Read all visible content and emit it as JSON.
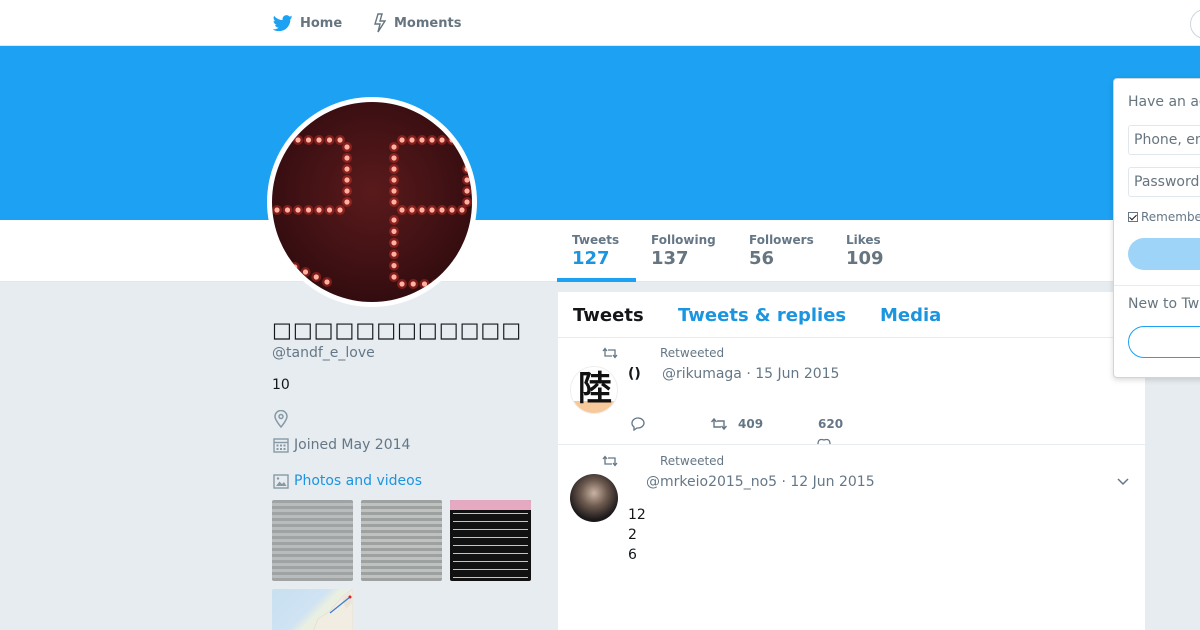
{
  "nav": {
    "home_label": "Home",
    "moments_label": "Moments"
  },
  "profile": {
    "name": "□□□□□□□□□□□□",
    "handle": "@tandf_e_love",
    "bio": "10",
    "joined": "Joined May 2014",
    "photos_label": "Photos and videos",
    "avatar_digits": "28"
  },
  "stats": [
    {
      "label": "Tweets",
      "value": "127"
    },
    {
      "label": "Following",
      "value": "137"
    },
    {
      "label": "Followers",
      "value": "56"
    },
    {
      "label": "Likes",
      "value": "109"
    }
  ],
  "tabs": {
    "tweets": "Tweets",
    "replies": "Tweets & replies",
    "media": "Media"
  },
  "tweets": [
    {
      "retweeted_label": "Retweeted",
      "name": "()",
      "meta": "@rikumaga · 15 Jun 2015",
      "avatar_glyph": "陸",
      "body": [],
      "retweets": "409",
      "likes": "620"
    },
    {
      "retweeted_label": "Retweeted",
      "name": "",
      "meta": "@mrkeio2015_no5 · 12 Jun 2015",
      "body": [
        "12",
        "2",
        "6"
      ]
    }
  ],
  "login": {
    "title": "Have an account?",
    "phone_placeholder": "Phone, email or username",
    "password_placeholder": "Password",
    "remember": "Remember me",
    "new_to": "New to Twitter?"
  },
  "colors": {
    "brand": "#1da1f2",
    "link": "#1b95e0",
    "muted": "#657786"
  }
}
